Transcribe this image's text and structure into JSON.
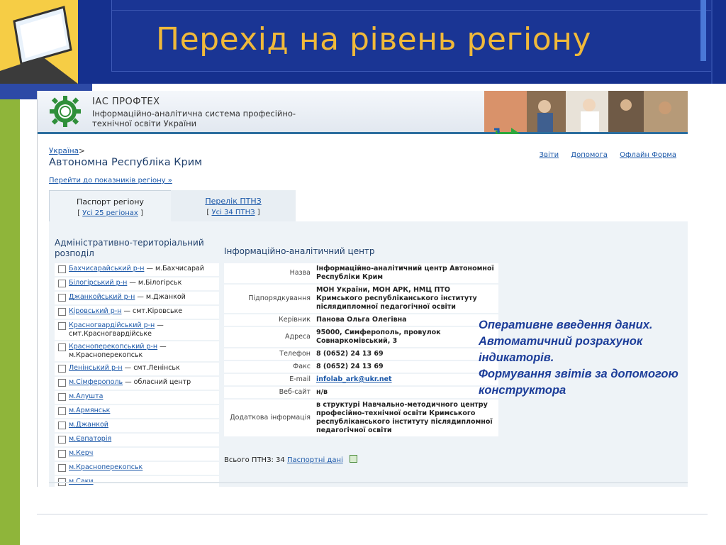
{
  "slide": {
    "title": "Перехід на рівень регіону",
    "callout_lines": [
      "Оперативне введення даних.",
      "Автоматичний розрахунок",
      "індикаторів.",
      "Формування звітів за допомогою",
      "конструктора"
    ],
    "colors": {
      "title": "#f0b93a",
      "title_bg": "#15308e",
      "accent_green": "#8fb53a",
      "callout": "#1c3d99"
    }
  },
  "app": {
    "brand": "ІАС ПРОФТЕХ",
    "brand_desc_1": "Інформаційно-аналітична система професійно-",
    "brand_desc_2": "технічної освіти України",
    "breadcrumb_root": "Україна",
    "breadcrumb_sep": ">",
    "region_title": "Автономна Республіка Крим",
    "top_links": [
      "Звіти",
      "Допомога",
      "Офлайн Форма"
    ],
    "goto_link": "Перейти до показників регіону »",
    "tabs": [
      {
        "label": "Паспорт регіону",
        "sub_open": "[",
        "sub_link": "Усі 25 регіонах",
        "sub_close": "]"
      },
      {
        "label": "Перелік ПТНЗ",
        "sub_open": "[",
        "sub_link": "Усі 34 ПТНЗ",
        "sub_close": "]"
      }
    ],
    "left_heading": "Адміністративно-територіальний розподіл",
    "mid_heading": "Інформаційно-аналітичний центр",
    "districts": [
      {
        "link": "Бахчисарайський р-н",
        "rest": " — м.Бахчисарай"
      },
      {
        "link": "Білогірський р-н",
        "rest": " — м.Білогірськ"
      },
      {
        "link": "Джанкойський р-н",
        "rest": " — м.Джанкой"
      },
      {
        "link": "Кіровський р-н",
        "rest": " — смт.Кіровське"
      },
      {
        "link": "Красногвардійський р-н",
        "rest": " — смт.Красногвардійське"
      },
      {
        "link": "Красноперекопський р-н",
        "rest": " — м.Красноперекопськ"
      },
      {
        "link": "Ленінський р-н",
        "rest": " — смт.Ленінськ"
      },
      {
        "link": "м.Сімферополь",
        "rest": " — обласний центр"
      },
      {
        "link": "м.Алушта",
        "rest": ""
      },
      {
        "link": "м.Армянськ",
        "rest": ""
      },
      {
        "link": "м.Джанкой",
        "rest": ""
      },
      {
        "link": "м.Євпаторія",
        "rest": ""
      },
      {
        "link": "м.Керч",
        "rest": ""
      },
      {
        "link": "м.Красноперекопськ",
        "rest": ""
      },
      {
        "link": "м.Саки",
        "rest": ""
      }
    ],
    "info": [
      {
        "key": "Назва",
        "value": "Інформаційно-аналітичний центр Автономної Республіки Крим"
      },
      {
        "key": "Підпорядкування",
        "value": "МОН України, МОН АРК, НМЦ ПТО Кримського республіканського інституту післядипломної педагогічної освіти"
      },
      {
        "key": "Керівник",
        "value": "Панова Ольга Олегівна"
      },
      {
        "key": "Адреса",
        "value": "95000, Симферополь, провулок Совнаркомівський, 3"
      },
      {
        "key": "Телефон",
        "value": "8 (0652) 24 13 69"
      },
      {
        "key": "Факс",
        "value": "8 (0652) 24 13 69"
      },
      {
        "key": "E-mail",
        "value": "infolab_ark@ukr.net",
        "link": true
      },
      {
        "key": "Веб-сайт",
        "value": "н/в"
      },
      {
        "key": "Додаткова інформація",
        "value": "в структурі Навчально-методичного центру професійно-технічної освіти Кримського республіканського інституту післядипломної педагогічної освіти"
      }
    ],
    "total_label": "Всього ПТНЗ: 34",
    "total_link": "Паспортні дані"
  }
}
